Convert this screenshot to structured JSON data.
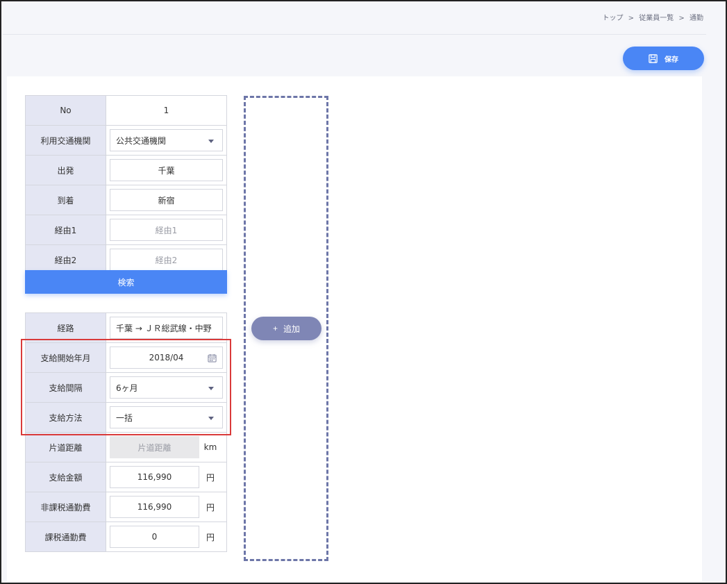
{
  "breadcrumb": [
    "トップ",
    "従業員一覧",
    "通勤"
  ],
  "breadcrumb_sep": ">",
  "save_button": {
    "label": "保存",
    "icon": "save-icon"
  },
  "route_form": {
    "rows": [
      {
        "label": "No",
        "value": "1"
      },
      {
        "label": "利用交通機関",
        "value": "公共交通機関"
      },
      {
        "label": "出発",
        "value": "千葉"
      },
      {
        "label": "到着",
        "value": "新宿"
      },
      {
        "label": "経由1",
        "placeholder": "経由1"
      },
      {
        "label": "経由2",
        "placeholder": "経由2"
      }
    ],
    "search_label": "検索"
  },
  "payment_form": {
    "rows": [
      {
        "label": "経路",
        "value": "千葉 → ＪＲ総武線・中野"
      },
      {
        "label": "支給開始年月",
        "value": "2018/04"
      },
      {
        "label": "支給間隔",
        "value": "6ヶ月"
      },
      {
        "label": "支給方法",
        "value": "一括"
      },
      {
        "label": "片道距離",
        "placeholder": "片道距離",
        "unit": "km"
      },
      {
        "label": "支給金額",
        "value": "116,990",
        "unit": "円"
      },
      {
        "label": "非課税通勤費",
        "value": "116,990",
        "unit": "円"
      },
      {
        "label": "課税通勤費",
        "value": "0",
        "unit": "円"
      }
    ]
  },
  "add_button": {
    "label": "追加",
    "prefix": "+"
  },
  "colors": {
    "primary": "#4a86f5",
    "secondary": "#7f86b5",
    "highlight": "#d93a3a",
    "label_bg": "#e4e6f3"
  }
}
